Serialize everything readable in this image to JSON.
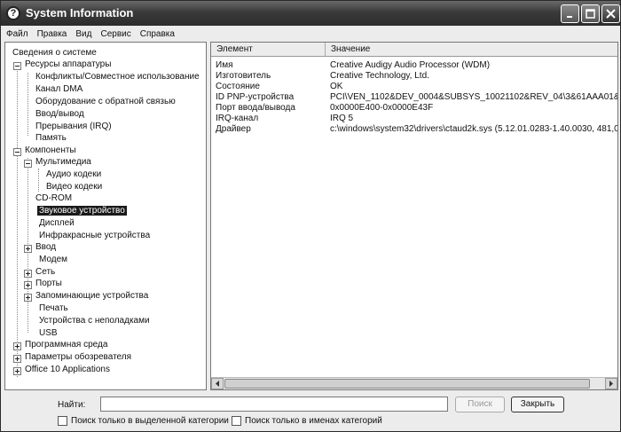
{
  "window": {
    "title": "System Information"
  },
  "menu": [
    "Файл",
    "Правка",
    "Вид",
    "Сервис",
    "Справка"
  ],
  "tree": [
    {
      "label": "Сведения о системе",
      "name": "tree-item-system-summary"
    },
    {
      "label": "Ресурсы аппаратуры",
      "name": "tree-item-hardware-resources",
      "expander": "minus"
    },
    {
      "label": "Конфликты/Совместное использование",
      "name": "tree-item-conflicts"
    },
    {
      "label": "Канал DMA",
      "name": "tree-item-dma"
    },
    {
      "label": "Оборудование с обратной связью",
      "name": "tree-item-forced-hardware"
    },
    {
      "label": "Ввод/вывод",
      "name": "tree-item-io"
    },
    {
      "label": "Прерывания (IRQ)",
      "name": "tree-item-irq"
    },
    {
      "label": "Память",
      "name": "tree-item-memory"
    },
    {
      "label": "Компоненты",
      "name": "tree-item-components",
      "expander": "minus"
    },
    {
      "label": "Мультимедиа",
      "name": "tree-item-multimedia",
      "expander": "minus"
    },
    {
      "label": "Аудио кодеки",
      "name": "tree-item-audio-codecs"
    },
    {
      "label": "Видео кодеки",
      "name": "tree-item-video-codecs"
    },
    {
      "label": "CD-ROM",
      "name": "tree-item-cdrom"
    },
    {
      "label": "Звуковое устройство",
      "name": "tree-item-sound-device",
      "selected": true
    },
    {
      "label": "Дисплей",
      "name": "tree-item-display"
    },
    {
      "label": "Инфракрасные устройства",
      "name": "tree-item-infrared"
    },
    {
      "label": "Ввод",
      "name": "tree-item-input",
      "expander": "plus"
    },
    {
      "label": "Модем",
      "name": "tree-item-modem"
    },
    {
      "label": "Сеть",
      "name": "tree-item-network",
      "expander": "plus"
    },
    {
      "label": "Порты",
      "name": "tree-item-ports",
      "expander": "plus"
    },
    {
      "label": "Запоминающие устройства",
      "name": "tree-item-storage",
      "expander": "plus"
    },
    {
      "label": "Печать",
      "name": "tree-item-printing"
    },
    {
      "label": "Устройства с неполадками",
      "name": "tree-item-problem-devices"
    },
    {
      "label": "USB",
      "name": "tree-item-usb"
    },
    {
      "label": "Программная среда",
      "name": "tree-item-software-environment",
      "expander": "plus"
    },
    {
      "label": "Параметры обозревателя",
      "name": "tree-item-browser-settings",
      "expander": "plus"
    },
    {
      "label": "Office 10 Applications",
      "name": "tree-item-office-apps",
      "expander": "plus"
    }
  ],
  "list": {
    "columns": [
      "Элемент",
      "Значение"
    ],
    "rows": [
      [
        "Имя",
        "Creative Audigy Audio Processor (WDM)"
      ],
      [
        "Изготовитель",
        "Creative Technology, Ltd."
      ],
      [
        "Состояние",
        "OK"
      ],
      [
        "ID PNP-устройства",
        "PCI\\VEN_1102&DEV_0004&SUBSYS_10021102&REV_04\\3&61AAA01&0&"
      ],
      [
        "Порт ввода/вывода",
        "0x0000E400-0x0000E43F"
      ],
      [
        "IRQ-канал",
        "IRQ 5"
      ],
      [
        "Драйвер",
        "c:\\windows\\system32\\drivers\\ctaud2k.sys (5.12.01.0283-1.40.0030, 481,05 K"
      ]
    ]
  },
  "find": {
    "label": "Найти:",
    "value": "",
    "search_button": "Поиск",
    "close_button": "Закрыть",
    "option_selected_category": "Поиск только в выделенной категории",
    "option_category_names": "Поиск только в именах категорий"
  }
}
